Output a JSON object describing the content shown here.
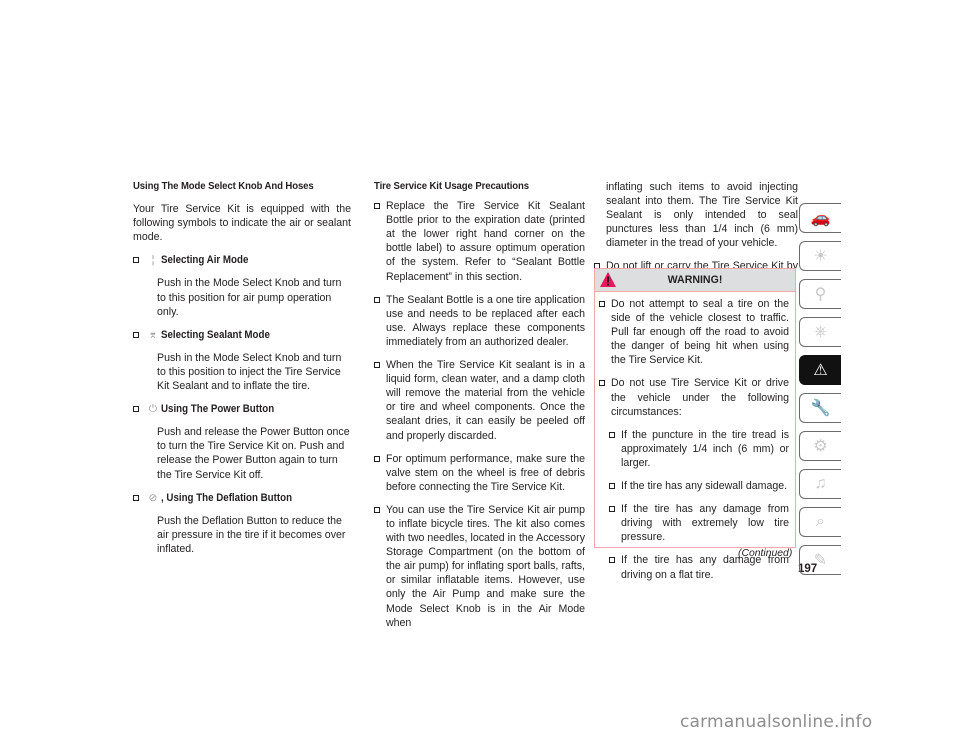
{
  "page": {
    "number": "197",
    "continued_label": "(Continued)",
    "watermark": "carmanualsonline.info"
  },
  "column1": {
    "heading": "Using The Mode Select Knob And Hoses",
    "intro": "Your Tire Service Kit is equipped with the following symbols to indicate the air or sealant mode.",
    "items": [
      {
        "icon": "air-mode-icon",
        "glyph": "¦",
        "title": "Selecting Air Mode",
        "body": "Push in the Mode Select Knob and turn to this position for air pump operation only."
      },
      {
        "icon": "sealant-mode-icon",
        "glyph": "⌆",
        "title": "Selecting Sealant Mode",
        "body": "Push in the Mode Select Knob and turn to this position to inject the Tire Service Kit Sealant and to inflate the tire."
      },
      {
        "icon": "power-icon",
        "glyph": "⏻",
        "title": "Using The Power Button",
        "body": "Push and release the Power Button once to turn the Tire Service Kit on. Push and release the Power Button again to turn the Tire Service Kit off."
      },
      {
        "icon": "deflation-icon",
        "glyph": "⊘",
        "title": ", Using The Deflation Button",
        "body": "Push the Deflation Button to reduce the air pressure in the tire if it becomes over inflated."
      }
    ]
  },
  "column2": {
    "heading": "Tire Service Kit Usage Precautions",
    "bullets": [
      "Replace the Tire Service Kit Sealant Bottle prior to the expiration date (printed at the lower right hand corner on the bottle label) to assure optimum operation of the system. Refer to “Sealant Bottle Replacement” in this section.",
      "The Sealant Bottle is a one tire application use and needs to be replaced after each use. Always replace these components immediately from an authorized dealer.",
      "When the Tire Service Kit sealant is in a liquid form, clean water, and a damp cloth will remove the material from the vehicle or tire and wheel components. Once the sealant dries, it can easily be peeled off and properly discarded.",
      "For optimum performance, make sure the valve stem on the wheel is free of debris before connecting the Tire Service Kit.",
      "You can use the Tire Service Kit air pump to inflate bicycle tires. The kit also comes with two needles, located in the Accessory Storage Compartment (on the bottom of the air pump) for inflating sport balls, rafts, or similar inflatable items. However, use only the Air Pump and make sure the Mode Select Knob is in the Air Mode when"
    ]
  },
  "column3": {
    "continuation": "inflating such items to avoid injecting sealant into them. The Tire Service Kit Sealant is only intended to seal punctures less than 1/4 inch (6 mm) diameter in the tread of your vehicle.",
    "bullets": [
      "Do not lift or carry the Tire Service Kit by the hoses."
    ]
  },
  "warning": {
    "title": "WARNING!",
    "bullets": [
      "Do not attempt to seal a tire on the side of the vehicle closest to traffic. Pull far enough off the road to avoid the danger of being hit when using the Tire Service Kit.",
      "Do not use Tire Service Kit or drive the vehicle under the following circumstances:"
    ],
    "sub_bullets": [
      "If the puncture in the tire tread is approximately 1/4 inch (6 mm) or larger.",
      "If the tire has any sidewall damage.",
      "If the tire has any damage from driving with extremely low tire pressure.",
      "If the tire has any damage from driving on a flat tire."
    ],
    "colors": {
      "border": "#f2a7ae",
      "header_bg": "#dcdedf",
      "triangle": "#e8175d"
    }
  },
  "section_tabs": [
    {
      "name": "vehicle-info-tab",
      "glyph": "🚗",
      "active": false
    },
    {
      "name": "lights-messages-tab",
      "glyph": "☀",
      "active": false
    },
    {
      "name": "safety-airbag-tab",
      "glyph": "⚲",
      "active": false
    },
    {
      "name": "starting-driving-tab",
      "glyph": "⎈",
      "active": false
    },
    {
      "name": "emergency-tab",
      "glyph": "⚠",
      "active": true
    },
    {
      "name": "service-maintenance-tab",
      "glyph": "🔧",
      "active": false
    },
    {
      "name": "specifications-tab",
      "glyph": "⚙",
      "active": false
    },
    {
      "name": "multimedia-tab",
      "glyph": "♫",
      "active": false
    },
    {
      "name": "index-search-tab",
      "glyph": "⌕",
      "active": false
    },
    {
      "name": "languages-tab",
      "glyph": "✎",
      "active": false
    }
  ]
}
